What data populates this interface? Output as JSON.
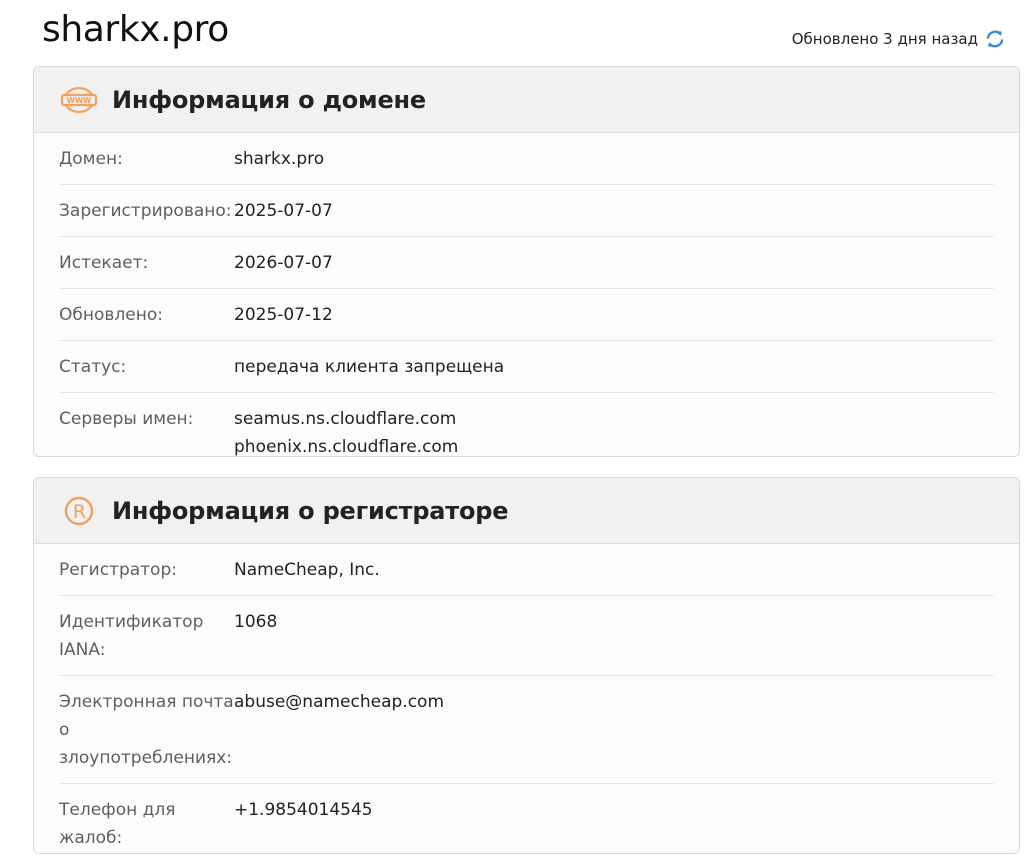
{
  "header": {
    "domain": "sharkx.pro",
    "updated_text": "Обновлено 3 дня назад",
    "refresh_icon": "refresh-icon",
    "accent_color": "#3b8ad9"
  },
  "domain_info": {
    "title": "Информация о домене",
    "icon": "www-icon",
    "rows": {
      "domain": {
        "label": "Домен:",
        "value": "sharkx.pro"
      },
      "registered": {
        "label": "Зарегистрировано:",
        "value": "2025-07-07"
      },
      "expires": {
        "label": "Истекает:",
        "value": "2026-07-07"
      },
      "updated": {
        "label": "Обновлено:",
        "value": "2025-07-12"
      },
      "status": {
        "label": "Статус:",
        "value": "передача клиента запрещена"
      },
      "nameservers": {
        "label": "Серверы имен:",
        "values": [
          "seamus.ns.cloudflare.com",
          "phoenix.ns.cloudflare.com"
        ]
      }
    }
  },
  "registrar_info": {
    "title": "Информация о регистраторе",
    "icon": "registered-icon",
    "rows": {
      "registrar": {
        "label": "Регистратор:",
        "value": "NameCheap, Inc."
      },
      "iana": {
        "label": "Идентификатор IANA:",
        "value": "1068"
      },
      "abuse_email": {
        "label": "Электронная почта о злоупотреблениях:",
        "value": "abuse@namecheap.com"
      },
      "phone": {
        "label": "Телефон для жалоб:",
        "value": "+1.9854014545"
      }
    }
  },
  "colors": {
    "icon_orange": "#f5a05a"
  }
}
